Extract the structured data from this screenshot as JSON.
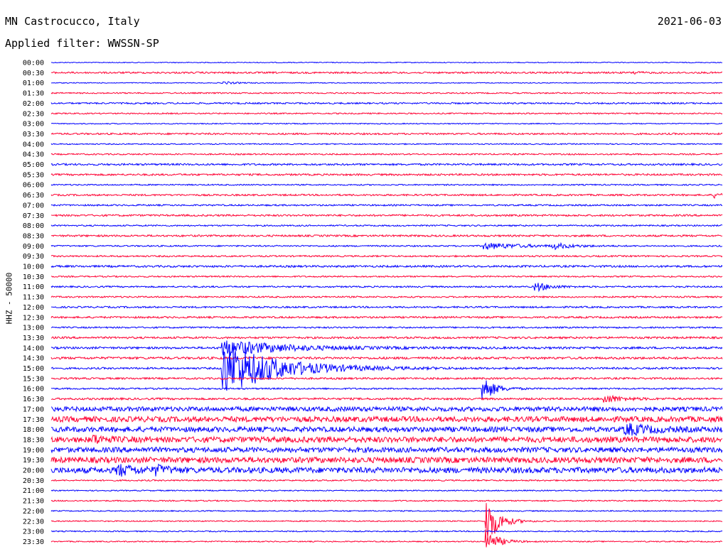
{
  "header": {
    "station": "MN Castrocucco, Italy",
    "date": "2021-06-03",
    "filter": "Applied filter: WWSSN-SP",
    "channel": "HHZ - 50000"
  },
  "colors": {
    "even": "#0000ff",
    "odd": "#ff0033"
  },
  "chart_data": {
    "type": "line",
    "title": "MN Castrocucco, Italy",
    "ylabel": "HHZ - 50000",
    "trace_labels": [
      "00:00",
      "00:30",
      "01:00",
      "01:30",
      "02:00",
      "02:30",
      "03:00",
      "03:30",
      "04:00",
      "04:30",
      "05:00",
      "05:30",
      "06:00",
      "06:30",
      "07:00",
      "07:30",
      "08:00",
      "08:30",
      "09:00",
      "09:30",
      "10:00",
      "10:30",
      "11:00",
      "11:30",
      "12:00",
      "12:30",
      "13:00",
      "13:30",
      "14:00",
      "14:30",
      "15:00",
      "15:30",
      "16:00",
      "16:30",
      "17:00",
      "17:30",
      "18:00",
      "18:30",
      "19:00",
      "19:30",
      "20:00",
      "20:30",
      "21:00",
      "21:30",
      "22:00",
      "22:30",
      "23:00",
      "23:30"
    ],
    "trace_minutes": 30,
    "noise_level": [
      0.6,
      1.2,
      0.6,
      0.9,
      1.1,
      0.9,
      0.7,
      1.2,
      0.8,
      1.0,
      1.3,
      1.3,
      0.9,
      1.2,
      1.1,
      1.3,
      1.0,
      1.3,
      1.0,
      1.1,
      1.4,
      1.0,
      1.1,
      1.1,
      1.2,
      1.3,
      1.1,
      1.4,
      1.5,
      1.6,
      1.3,
      1.3,
      1.1,
      1.4,
      3.2,
      3.8,
      3.6,
      4.0,
      3.6,
      4.0,
      4.0,
      1.0,
      0.8,
      0.9,
      0.8,
      0.8,
      0.8,
      0.8
    ],
    "events": [
      {
        "trace": "00:30",
        "minute": 26.0,
        "amplitude": 2.5,
        "duration": 0.5
      },
      {
        "trace": "01:00",
        "minute": 7.6,
        "amplitude": 2.0,
        "duration": 1.2
      },
      {
        "trace": "06:30",
        "minute": 29.6,
        "amplitude": 4.0,
        "duration": 0.6
      },
      {
        "trace": "09:00",
        "minute": 19.3,
        "amplitude": 5.0,
        "duration": 3.0
      },
      {
        "trace": "09:00",
        "minute": 22.4,
        "amplitude": 4.0,
        "duration": 1.5
      },
      {
        "trace": "11:00",
        "minute": 21.6,
        "amplitude": 7.0,
        "duration": 1.2
      },
      {
        "trace": "14:00",
        "minute": 7.6,
        "amplitude": 12.0,
        "duration": 5.0
      },
      {
        "trace": "15:00",
        "minute": 7.6,
        "amplitude": 40.0,
        "duration": 4.5
      },
      {
        "trace": "16:00",
        "minute": 19.2,
        "amplitude": 22.0,
        "duration": 1.0
      },
      {
        "trace": "16:30",
        "minute": 24.6,
        "amplitude": 7.0,
        "duration": 1.5
      },
      {
        "trace": "18:00",
        "minute": 25.6,
        "amplitude": 8.0,
        "duration": 2.0
      },
      {
        "trace": "18:30",
        "minute": 1.8,
        "amplitude": 6.0,
        "duration": 1.0
      },
      {
        "trace": "20:00",
        "minute": 2.9,
        "amplitude": 8.0,
        "duration": 1.5
      },
      {
        "trace": "20:00",
        "minute": 4.6,
        "amplitude": 6.0,
        "duration": 1.0
      },
      {
        "trace": "22:30",
        "minute": 19.4,
        "amplitude": 40.0,
        "duration": 1.0
      },
      {
        "trace": "23:30",
        "minute": 19.4,
        "amplitude": 18.0,
        "duration": 1.0
      }
    ]
  }
}
